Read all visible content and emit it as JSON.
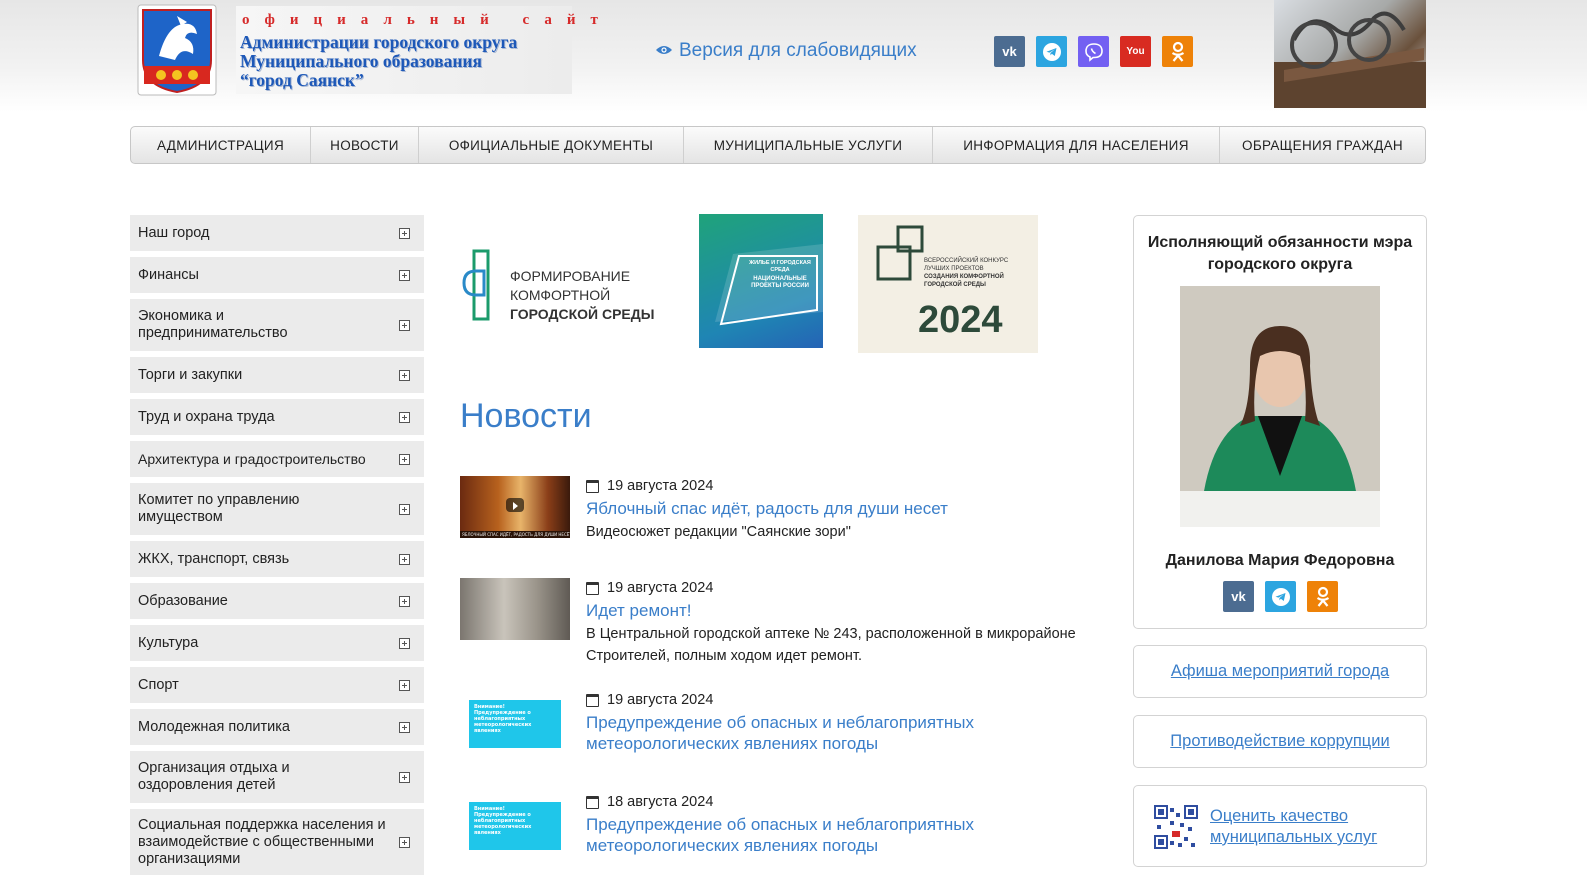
{
  "header": {
    "site_small": "официальный сайт",
    "site_line1": "Администрации городского округа",
    "site_line2": "Муниципального образования",
    "site_line3": "“город Саянск”",
    "vision_label": "Версия для слабовидящих",
    "social": [
      {
        "name": "vk",
        "label": "vk"
      },
      {
        "name": "telegram",
        "label": ""
      },
      {
        "name": "viber",
        "label": ""
      },
      {
        "name": "youtube",
        "label": "You"
      },
      {
        "name": "odnoklassniki",
        "label": "ok"
      }
    ]
  },
  "nav": {
    "items": [
      "АДМИНИСТРАЦИЯ",
      "НОВОСТИ",
      "ОФИЦИАЛЬНЫЕ ДОКУМЕНТЫ",
      "МУНИЦИПАЛЬНЫЕ УСЛУГИ",
      "ИНФОРМАЦИЯ ДЛЯ НАСЕЛЕНИЯ",
      "ОБРАЩЕНИЯ ГРАЖДАН"
    ]
  },
  "sidebar": {
    "items": [
      "Наш город",
      "Финансы",
      "Экономика и предпринимательство",
      "Торги и закупки",
      "Труд и охрана труда",
      "Архитектура и градостроительство",
      "Комитет по управлению имуществом",
      "ЖКХ, транспорт, связь",
      "Образование",
      "Культура",
      "Спорт",
      "Молодежная политика",
      "Организация отдыха и оздоровления детей",
      "Социальная поддержка населения и взаимодействие с общественными организациями"
    ]
  },
  "banners": {
    "b1_line1": "ФОРМИРОВАНИЕ",
    "b1_line2": "КОМФОРТНОЙ",
    "b1_line3": "ГОРОДСКОЙ СРЕДЫ",
    "b2_top": "ЖИЛЬЕ И ГОРОДСКАЯ СРЕДА",
    "b2_mid": "НАЦИОНАЛЬНЫЕ ПРОЕКТЫ РОССИИ",
    "b3_small1": "ВСЕРОССИЙСКИЙ КОНКУРС ЛУЧШИХ ПРОЕКТОВ",
    "b3_small2": "СОЗДАНИЯ КОМФОРТНОЙ ГОРОДСКОЙ СРЕДЫ",
    "b3_year": "2024"
  },
  "news": {
    "title": "Новости",
    "items": [
      {
        "date": "19 августа 2024",
        "title": "Яблочный спас идёт, радость для души несет",
        "desc": "Видеосюжет редакции \"Саянские зори\"",
        "thumb_text": "ЯБЛОЧНЫЙ СПАС ИДЁТ, РАДОСТЬ ДЛЯ ДУШИ НЕСЁТ"
      },
      {
        "date": "19 августа 2024",
        "title": "Идет ремонт!",
        "desc": "В Центральной городской аптеке № 243, расположенной в микрорайоне Строителей, полным ходом идет ремонт."
      },
      {
        "date": "19 августа 2024",
        "title": "Предупреждение об опасных и неблагоприятных метеорологических явлениях погоды",
        "desc": "",
        "thumb_text": "Внимание! Предупреждение о неблагоприятных метеорологических явлениях"
      },
      {
        "date": "18 августа 2024",
        "title": "Предупреждение об опасных и неблагоприятных метеорологических явлениях погоды",
        "desc": "",
        "thumb_text": "Внимание! Предупреждение о неблагоприятных метеорологических явлениях"
      }
    ]
  },
  "mayor": {
    "title": "Исполняющий обязанности мэра городского округа",
    "name": "Данилова Мария Федоровна",
    "social": [
      {
        "name": "vk",
        "label": "vk"
      },
      {
        "name": "telegram",
        "label": ""
      },
      {
        "name": "odnoklassniki",
        "label": "ok"
      }
    ]
  },
  "links": {
    "events": "Афиша мероприятий города",
    "anticorruption": "Противодействие коррупции",
    "rate_services": "Оценить качество муниципальных услуг"
  },
  "colors": {
    "accent": "#3a7ec9",
    "sidebar_bg": "#ebebeb"
  }
}
